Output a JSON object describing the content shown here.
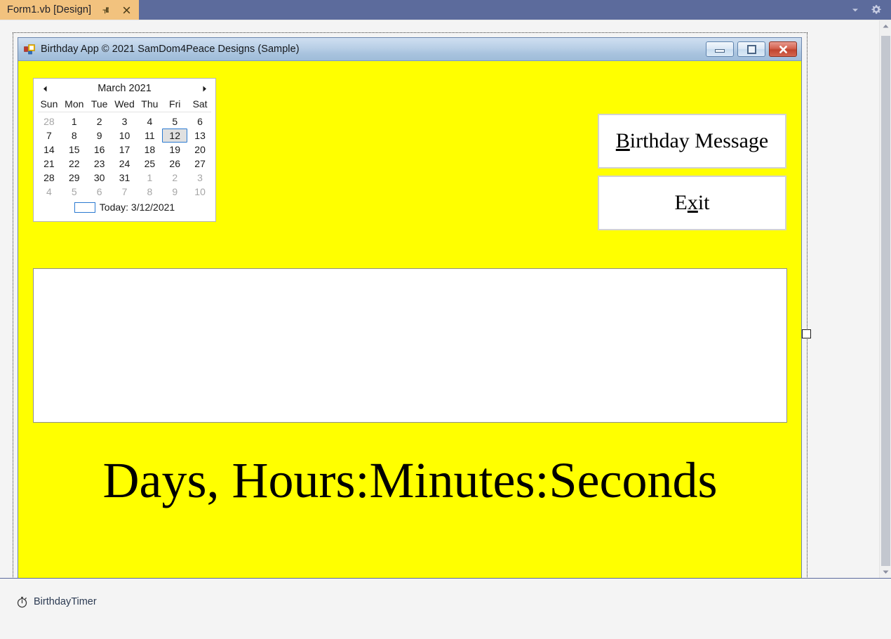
{
  "vs": {
    "tab": {
      "title": "Form1.vb [Design]",
      "pin_icon": "pin-icon",
      "close_icon": "close-icon"
    },
    "toolbar": {
      "dropdown_icon": "chevron-down-icon",
      "settings_icon": "gear-icon"
    }
  },
  "form": {
    "title": "Birthday App © 2021 SamDom4Peace Designs (Sample)",
    "icon": "vb-form-icon",
    "window_controls": {
      "minimize": "minimize-icon",
      "maximize": "maximize-icon",
      "close": "close-icon"
    },
    "background_color": "#ffff00"
  },
  "calendar": {
    "prev_icon": "triangle-left-icon",
    "next_icon": "triangle-right-icon",
    "title": "March 2021",
    "day_names": [
      "Sun",
      "Mon",
      "Tue",
      "Wed",
      "Thu",
      "Fri",
      "Sat"
    ],
    "weeks": [
      [
        {
          "d": "28",
          "dim": true
        },
        {
          "d": "1"
        },
        {
          "d": "2"
        },
        {
          "d": "3"
        },
        {
          "d": "4"
        },
        {
          "d": "5"
        },
        {
          "d": "6"
        }
      ],
      [
        {
          "d": "7"
        },
        {
          "d": "8"
        },
        {
          "d": "9"
        },
        {
          "d": "10"
        },
        {
          "d": "11"
        },
        {
          "d": "12",
          "selected": true
        },
        {
          "d": "13"
        }
      ],
      [
        {
          "d": "14"
        },
        {
          "d": "15"
        },
        {
          "d": "16"
        },
        {
          "d": "17"
        },
        {
          "d": "18"
        },
        {
          "d": "19"
        },
        {
          "d": "20"
        }
      ],
      [
        {
          "d": "21"
        },
        {
          "d": "22"
        },
        {
          "d": "23"
        },
        {
          "d": "24"
        },
        {
          "d": "25"
        },
        {
          "d": "26"
        },
        {
          "d": "27"
        }
      ],
      [
        {
          "d": "28"
        },
        {
          "d": "29"
        },
        {
          "d": "30"
        },
        {
          "d": "31"
        },
        {
          "d": "1",
          "dim": true
        },
        {
          "d": "2",
          "dim": true
        },
        {
          "d": "3",
          "dim": true
        }
      ],
      [
        {
          "d": "4",
          "dim": true
        },
        {
          "d": "5",
          "dim": true
        },
        {
          "d": "6",
          "dim": true
        },
        {
          "d": "7",
          "dim": true
        },
        {
          "d": "8",
          "dim": true
        },
        {
          "d": "9",
          "dim": true
        },
        {
          "d": "10",
          "dim": true
        }
      ]
    ],
    "today_label": "Today: 3/12/2021",
    "selected_date": "12",
    "selection_border_color": "#2b7ad1"
  },
  "buttons": {
    "birthday_message": {
      "accelerator": "B",
      "rest": "irthday Message",
      "full_label": "Birthday Message"
    },
    "exit": {
      "prefix": "E",
      "accelerator": "x",
      "suffix": "it",
      "full_label": "Exit"
    }
  },
  "textbox": {
    "value": "",
    "placeholder": ""
  },
  "countdown": {
    "label": "Days, Hours:Minutes:Seconds"
  },
  "scrollbar": {
    "up_icon": "scroll-up-icon",
    "down_icon": "scroll-down-icon"
  },
  "component_tray": {
    "items": [
      {
        "icon": "timer-icon",
        "label": "BirthdayTimer"
      }
    ]
  }
}
